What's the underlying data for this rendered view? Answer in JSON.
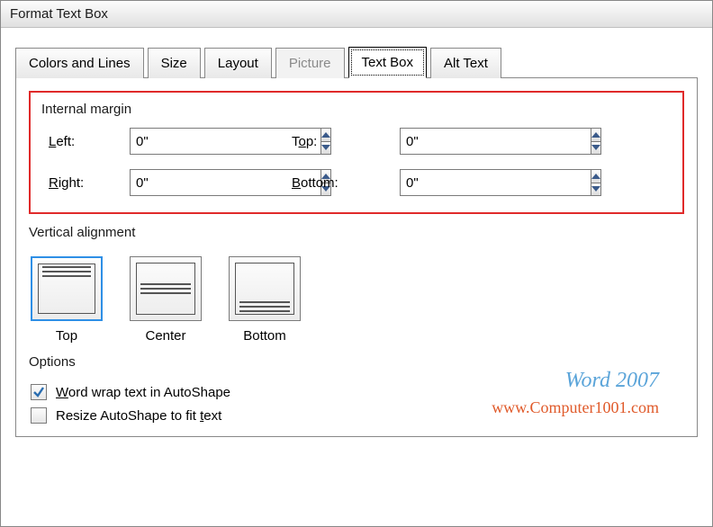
{
  "window": {
    "title": "Format Text Box"
  },
  "tabs": {
    "colors": "Colors and Lines",
    "size": "Size",
    "layout": "Layout",
    "picture": "Picture",
    "textbox": "Text Box",
    "alttext": "Alt Text",
    "active": "textbox",
    "disabled": "picture"
  },
  "internal_margin": {
    "title": "Internal margin",
    "left": {
      "label_pre": "",
      "label_ul": "L",
      "label_post": "eft:",
      "value": "0\""
    },
    "right": {
      "label_pre": "",
      "label_ul": "R",
      "label_post": "ight:",
      "value": "0\""
    },
    "top": {
      "label_pre": "T",
      "label_ul": "o",
      "label_post": "p:",
      "value": "0\""
    },
    "bottom": {
      "label_pre": "",
      "label_ul": "B",
      "label_post": "ottom:",
      "value": "0\""
    }
  },
  "vertical_alignment": {
    "title": "Vertical alignment",
    "top": "Top",
    "center": "Center",
    "bottom": "Bottom",
    "selected": "top"
  },
  "options": {
    "title": "Options",
    "wrap": {
      "pre": "",
      "ul": "W",
      "post": "ord wrap text in AutoShape",
      "checked": true
    },
    "resize": {
      "pre": "Resize AutoShape to fit ",
      "ul": "t",
      "post": "ext",
      "checked": false
    }
  },
  "watermark": {
    "line1": "Word 2007",
    "line2": "www.Computer1001.com"
  }
}
